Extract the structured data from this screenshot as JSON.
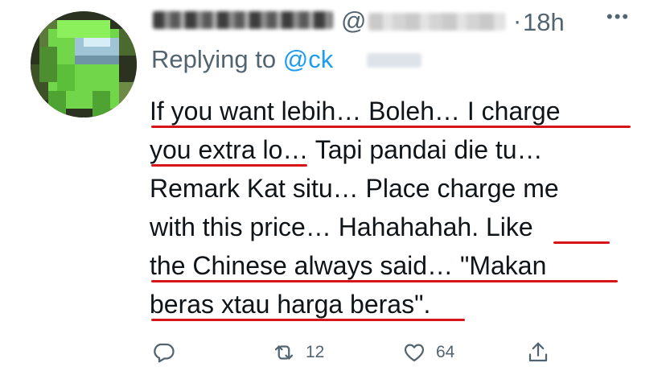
{
  "tweet": {
    "handle_prefix": "@",
    "dot": "·",
    "time": "18h",
    "more_icon": "more-dots-icon",
    "replying_prefix": "Replying to ",
    "replying_handle": "@ck",
    "body_lines": [
      "If you want lebih… Boleh… I charge",
      "you extra lo… Tapi pandai die tu…",
      "Remark Kat situ… Place charge me",
      "with this price… Hahahahah. Like",
      "the Chinese always said… \"Makan",
      "beras xtau harga beras\"."
    ],
    "highlight_color": "#d8141b",
    "link_color": "#1d9bf0",
    "secondary_color": "#536471",
    "actions": {
      "reply_icon": "reply-icon",
      "retweet_icon": "retweet-icon",
      "retweet_count": "12",
      "like_icon": "heart-icon",
      "like_count": "64",
      "share_icon": "share-icon"
    }
  }
}
